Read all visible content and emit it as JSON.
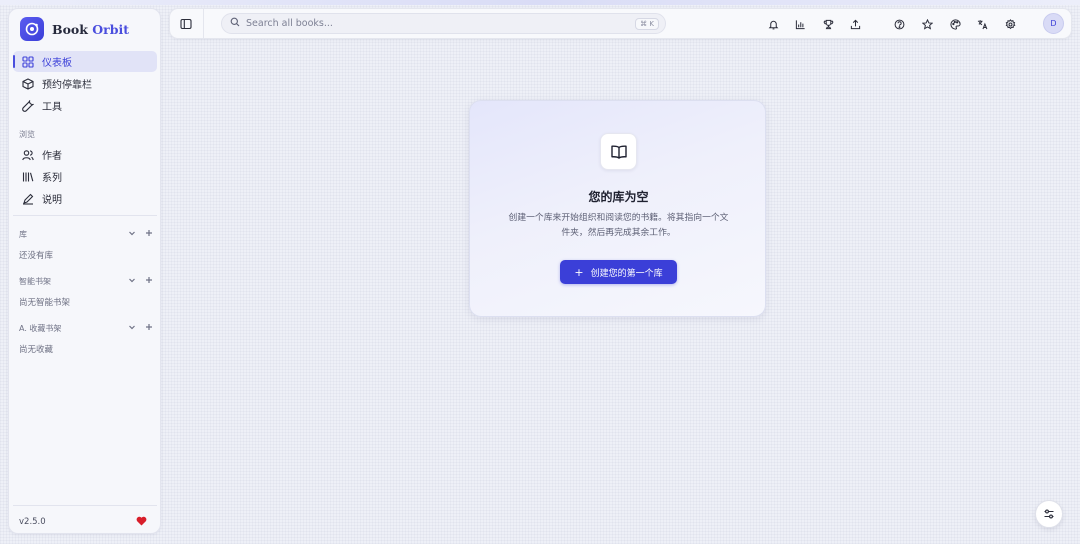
{
  "app": {
    "brand_part1": "Book",
    "brand_part2": "Orbit",
    "version": "v2.5.0"
  },
  "sidebar": {
    "nav": [
      {
        "label": "仪表板",
        "icon": "dashboard-icon",
        "active": true
      },
      {
        "label": "预约停靠栏",
        "icon": "box-icon"
      },
      {
        "label": "工具",
        "icon": "wrench-icon"
      }
    ],
    "browse_label": "浏览",
    "browse": [
      {
        "label": "作者",
        "icon": "users-icon"
      },
      {
        "label": "系列",
        "icon": "library-icon"
      },
      {
        "label": "说明",
        "icon": "pen-icon"
      }
    ],
    "libraries": {
      "label": "库",
      "empty": "还没有库"
    },
    "smart_shelves": {
      "label": "智能书架",
      "empty": "尚无智能书架"
    },
    "shelves": {
      "label": "A. 收藏书架",
      "empty": "尚无收藏"
    }
  },
  "topbar": {
    "search_placeholder": "Search all books...",
    "shortcut": "⌘ K",
    "avatar_initial": "D",
    "icons": [
      "bell-icon",
      "chart-icon",
      "trophy-icon",
      "upload-icon",
      "help-icon",
      "star-icon",
      "palette-icon",
      "translate-icon",
      "settings-icon"
    ]
  },
  "empty_state": {
    "title": "您的库为空",
    "description": "创建一个库来开始组织和阅读您的书籍。将其指向一个文件夹，然后再完成其余工作。",
    "button_label": "创建您的第一个库"
  },
  "colors": {
    "accent": "#3b3fd8",
    "heart": "#d81e2a"
  }
}
